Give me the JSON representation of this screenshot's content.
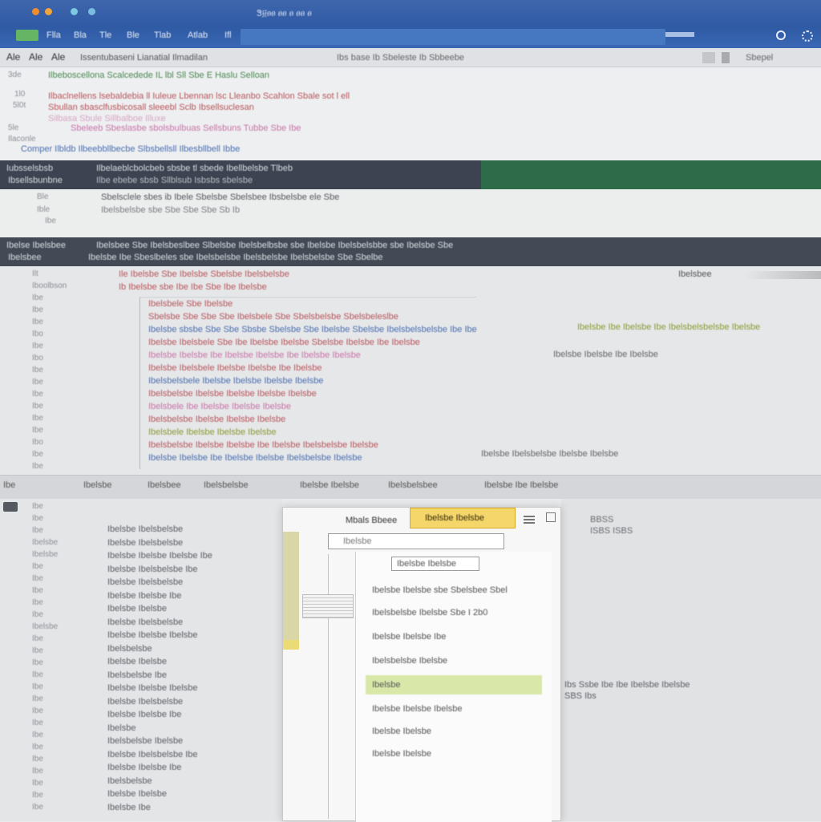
{
  "titlebar": {
    "title": "Ꮥ፱ፀፀ ፀፀ ፀ ፀፀ ፀ",
    "menu": [
      "Flla",
      "Bla",
      "Tle",
      "Ble",
      "Tlab",
      "Atlab",
      "Ifl"
    ],
    "right_icons": [
      "refresh-icon",
      "gear-icon"
    ]
  },
  "toolbar": {
    "items": [
      "Ale",
      "Ale",
      "Ale"
    ],
    "breadcrumb": "Issentubaseni Lianatial Ilmadilan",
    "center": "Ibs base Ib Sbeleste Ib   Sbbeebe",
    "right": "Sbepel"
  },
  "editor_top": {
    "line_numbers": [
      "3de",
      "1l0",
      "5l0t",
      "5le",
      "Ilaconle"
    ],
    "lines": [
      "Ilbeboscellona  Scalcedede IL lbl  Sll Sbe E Haslu Selloan",
      "Ilbaclnellens lsebaldebia ll  Iuleue Lbennan lsc Lleanbo Scahlon Sbale sot l ell",
      "Sbullan sbasclfusbicosall  sleeebl Sclb Ibsellsuclesan",
      "Silbasa Sbule Sillbalboe Illuxe",
      "Sbeleeb Sbeslasbe sbolsbulbuas Sellsbuns Tubbe Sbe Ibe",
      "Comper  Ilbldb  Ilbeebbllbecbe Slbsbellsll  Ilbesbllbell Ibbe"
    ]
  },
  "band_dark_1": {
    "left": "Iubsselsbsb",
    "sub": "Ibsellsbunbne",
    "text": "Ilbelaeblcbolcbeb sbsbe tl sbede Ibellbelsbe Tlbeb",
    "sub_text": "Ilbe ebebe sbsb Sllblsub Isbsbs sbelsbe"
  },
  "band_2": {
    "left": [
      "Ble",
      "Ible",
      "Ibe"
    ],
    "line1": "Sbelsclele  sbes ib Ibele Sbelsbe Sbelsbee  Ibsbelsbe  ele Sbe",
    "line2": "Ibelsbelsbe  sbe Sbe   Sbe Sbe   Sb Ib"
  },
  "band_dark_2": {
    "left": "Ibelse Ibelsbee",
    "text": "Ibelsbee Sbe Ibelsbeslbee Slbelsbe Ibelsbelbsbe sbe Ibelsbe  Ibelsbelsbbe  sbe Ibelsbe  Sbe",
    "sub_left": "Ibelsbee",
    "sub_text": "Ibelsbe Ibe Sbeslbeles sbe Ibelsbelsbe Ibelsbelsbe  Ibelsbelsbe Sbe Sbelbe"
  },
  "main_editor": {
    "gutter": [
      "Ilt",
      "Iboolbson",
      "Ibe",
      "Ibe",
      "Ibe",
      "Ibo",
      "Ibe",
      "Ibo",
      "Ibe",
      "Ibe",
      "Ibe",
      "Ibe",
      "Ibe",
      "Ibe",
      "Ibo",
      "Ibe",
      "Ibe"
    ],
    "header": "Ile Ibelsbe Sbe Ibelsbe Sbelsbe Ibelsbelsbe",
    "header2": "Ib Ibelsbe sbe  Ibe  Ibe Sbe   Ibe Ibelsbe",
    "right_label": "Ibelsbee",
    "code": [
      "Ibelsbele Sbe Ibelsbe",
      "Sbelsbe Sbe  Sbe Sbe Ibelsbele Sbe Sbelsbelsbe Sbelsbeleslbe",
      "Ibelsbe sbsbe  Sbe Sbe Sbsbe  Sbelsbe  Sbe Ibelsbe Sbelsbe Ibelsbelsbelsbe  Ibe  Ibelsbe",
      "Ibelsbe  Ibelsbele Sbe  Ibe  Ibelsbe  Ibelsbe Sbelsbe  Ibelsbe  Ibe  Ibelsbe",
      "Ibelsbe  Ibelsbe  Ibe Ibelsbe  Ibelsbe  Ibe  Ibelsbe Ibelsbe",
      "Ibelsbe  Ibelsbele  Ibelsbe  Ibelsbe  Ibe Ibelsbe",
      "Ibelsbelsbele  Ibelsbe  Ibelsbe  Ibelsbe Ibelsbe",
      "Ibelsbelsbe  Ibelsbe  Ibelsbe Ibelsbe  Ibelsbe",
      "Ibelsbele  Ibe  Ibelsbe  Ibelsbe Ibelsbe",
      "Ibelsbelsbe  Ibelsbe  Ibelsbe  Ibelsbe",
      "Ibelsbele Ibelsbe  Ibelsbe  Ibelsbe",
      "Ibelsbelsbe  Ibelsbe  Ibelsbe  Ibe  Ibelsbe  Ibelsbelsbe Ibelsbe",
      "Ibelsbe  Ibelsbe  Ibe  Ibelsbe  Ibelsbe Ibelsbelsbe  Ibelsbe"
    ],
    "right_cluster": [
      "Ibelsbe  Ibe  Ibelsbe  Ibe  Ibelsbelsbelsbe  Ibelsbe",
      "Ibelsbe Ibelsbe Ibe  Ibelsbe",
      "Ibelsbe  Ibelsbelsbe Ibelsbe Ibelsbe"
    ]
  },
  "status_strip": {
    "items": [
      "Ibe",
      "Ibelsbe",
      "Ibelsbee",
      "Ibelsbelsbe",
      "Ibelsbe Ibelsbe",
      "Ibelsbelsbee",
      "Ibelsbe Ibe Ibelsbe"
    ]
  },
  "lower_pane": {
    "gutter": [
      "Ibe",
      "Ibe",
      "Ibe",
      "Ibelsbe",
      "Ibelsbe",
      "Ibe",
      "Ibe",
      "Ibe",
      "Ibe",
      "Ibe",
      "Ibelsbe",
      "Ibe",
      "Ibe",
      "Ibe",
      "Ibe",
      "Ibe",
      "Ibe",
      "Ibe",
      "Ibe",
      "Ibe",
      "Ibe",
      "Ibe",
      "Ibe",
      "Ibe",
      "Ibe",
      "Ibe"
    ],
    "lines": [
      "Ibelsbe Ibelsbelsbe",
      "Ibelsbe  Ibelsbelsbe",
      "Ibelsbe Ibelsbe  Ibelsbe  Ibe",
      "Ibelsbe Ibelsbelsbe  Ibe",
      "Ibelsbe  Ibelsbelsbe",
      "Ibelsbe  Ibelsbe  Ibe",
      "Ibelsbe  Ibelsbe",
      "Ibelsbe  Ibelsbelsbe",
      "Ibelsbe  Ibelsbe  Ibelsbe",
      "Ibelsbelsbe",
      "Ibelsbe Ibelsbe",
      "Ibelsbelsbe  Ibe",
      "Ibelsbe  Ibelsbe  Ibelsbe",
      "Ibelsbe  Ibelsbelsbe",
      "Ibelsbe  Ibelsbe  Ibe",
      "Ibelsbe",
      "Ibelsbelsbe  Ibelsbe",
      "Ibelsbe  Ibelsbelsbe  Ibe",
      "Ibelsbe  Ibelsbe  Ibe",
      "Ibelsbelsbe",
      "Ibelsbe  Ibelsbe",
      "Ibelsbe  Ibe"
    ]
  },
  "right_lower": {
    "top1": "BBSS",
    "top2": "ISBS ISBS",
    "row1": "Ibs  Ssbe  Ibe  Ibe Ibelsbe  Ibelsbe",
    "row2": "SBS  Ibs"
  },
  "dialog": {
    "title": "Mbals Bbeee",
    "tab_label": "Ibelsbe Ibelsbe",
    "search_placeholder": "Ibelsbe",
    "field_label": "Ibelsbe Ibelsbe",
    "rows": [
      "Ibelsbe Ibelsbe sbe Sbelsbee Sbel",
      "Ibelsbelsbe Ibelsbe Sbe I 2b0",
      "Ibelsbe Ibelsbe  Ibe",
      "Ibelsbelsbe  Ibelsbe",
      "Ibelsbe",
      "Ibelsbe Ibelsbe  Ibelsbe",
      "Ibelsbe Ibelsbe",
      "Ibelsbe  Ibelsbe"
    ],
    "selected_index": 4
  }
}
